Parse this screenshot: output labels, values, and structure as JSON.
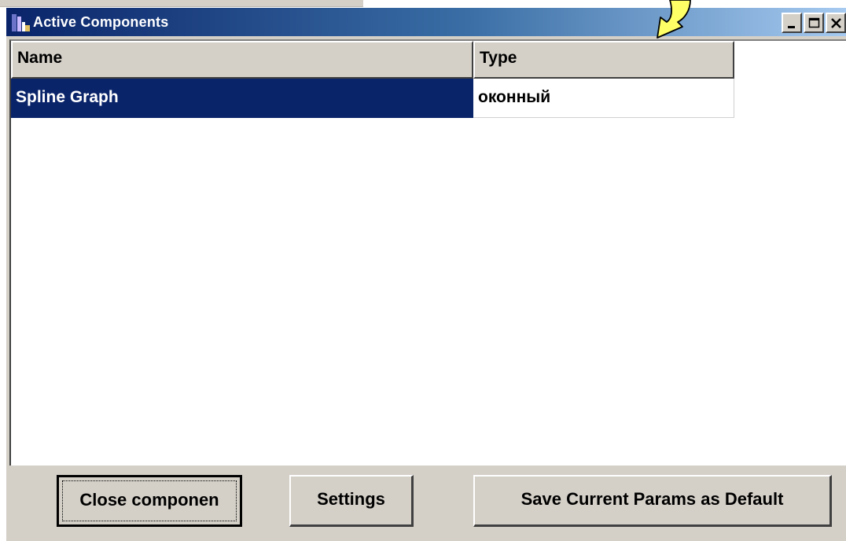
{
  "window": {
    "title": "Active Components",
    "controls": [
      "minimize-icon",
      "maximize-icon",
      "close-icon"
    ]
  },
  "list": {
    "columns": [
      "Name",
      "Type"
    ],
    "rows": [
      {
        "name": "Spline Graph",
        "type": "оконный",
        "selected": true
      }
    ]
  },
  "buttons": {
    "close_component": "Close componen",
    "settings": "Settings",
    "save_default": "Save Current Params as Default"
  },
  "colors": {
    "titlebar_start": "#0a246a",
    "titlebar_end": "#a6caf0",
    "selection": "#0a246a",
    "face": "#d4d0c8",
    "callout_arrow": "#ffff66"
  }
}
